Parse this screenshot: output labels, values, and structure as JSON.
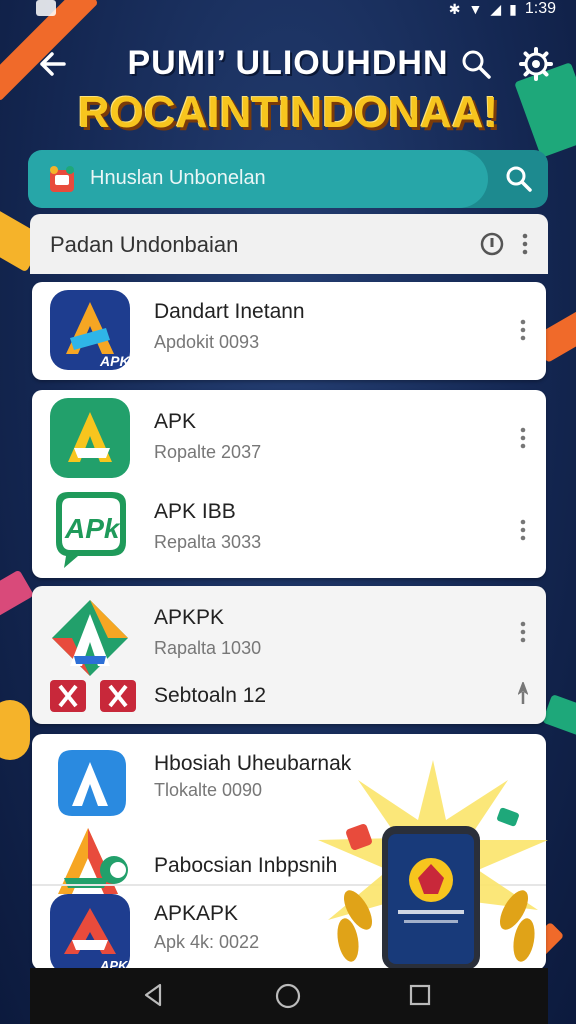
{
  "status": {
    "time": "1:39"
  },
  "header": {
    "title": "PUMI’ ULIOUHDHN",
    "subtitle": "ROCAINTINDONAA!"
  },
  "search": {
    "text": "Hnuslan Unbonelan"
  },
  "list": {
    "title": "Padan Undonbaian",
    "items": [
      {
        "name": "Dandart Inetann",
        "sub": "Apdokit 0093",
        "icon": "apk-orange-blue-icon"
      },
      {
        "name": "APK",
        "sub": "Ropalte 2037",
        "icon": "apk-green-icon"
      },
      {
        "name": "APK IBB",
        "sub": "Repalta 3033",
        "icon": "apk-green-badge-icon"
      },
      {
        "name": "APKPK",
        "sub": "Rapalta 1030",
        "icon": "apk-multicolor-icon"
      },
      {
        "name": "Sebtoaln 12",
        "sub": "",
        "icon": "flags-icon"
      },
      {
        "name": "Hbosiah Uheubarnak",
        "sub": "Tlokalte 0090",
        "icon": "apk-blue-icon"
      },
      {
        "name": "Pabocsian Inbpsnih",
        "sub": "",
        "icon": "apk-colored-icon"
      },
      {
        "name": "APKAPK",
        "sub": "Apk 4k: 0022",
        "icon": "apk-navy-icon"
      }
    ]
  },
  "colors": {
    "accent": "#27a6a8",
    "title_yellow": "#f7c51e",
    "background": "#1b2f5a"
  }
}
